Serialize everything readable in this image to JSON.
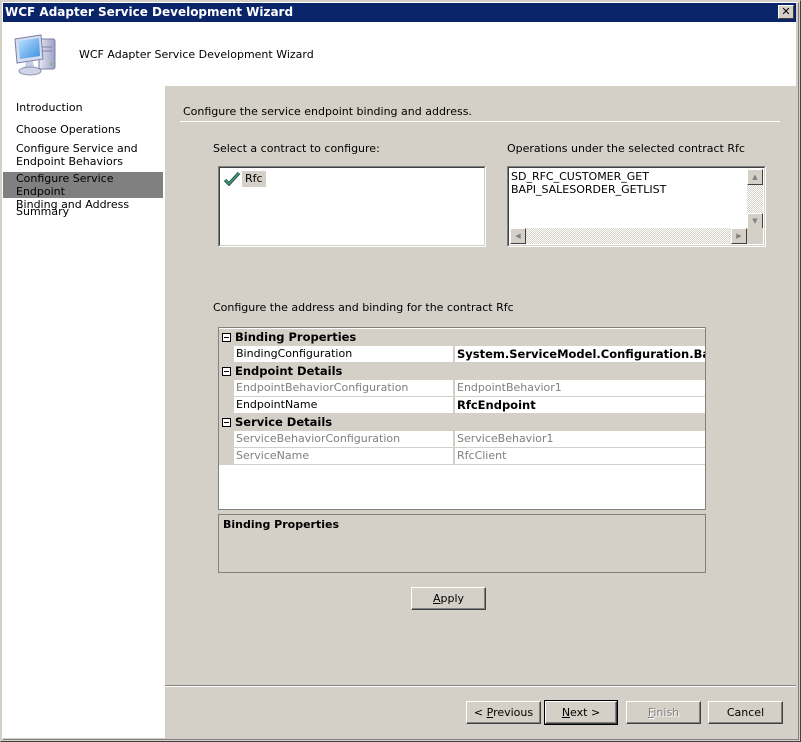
{
  "window": {
    "title": "WCF Adapter Service Development Wizard",
    "close_label": "✕"
  },
  "header": {
    "title": "WCF Adapter Service Development Wizard",
    "icon": "computer-icon"
  },
  "sidebar": {
    "items": [
      {
        "label": "Introduction",
        "active": false
      },
      {
        "label": "Choose Operations",
        "active": false
      },
      {
        "label": "Configure Service and Endpoint Behaviors",
        "line1": "Configure Service and",
        "line2": "Endpoint Behaviors",
        "active": false
      },
      {
        "label": "Configure Service Endpoint Binding and Address",
        "line1": "Configure Service Endpoint",
        "line2": "Binding and Address",
        "active": true
      },
      {
        "label": "Summary",
        "active": false
      }
    ]
  },
  "main": {
    "section_title": "Configure the service endpoint binding and address.",
    "contract_label": "Select a contract to configure:",
    "contracts": [
      {
        "name": "Rfc",
        "checked": true,
        "selected": true
      }
    ],
    "operations_label": "Operations under the selected contract  Rfc",
    "operations": [
      "SD_RFC_CUSTOMER_GET",
      "BAPI_SALESORDER_GETLIST"
    ],
    "address_label": "Configure the address and binding for the contract  Rfc",
    "property_grid": {
      "categories": [
        {
          "name": "Binding Properties",
          "expanded": true,
          "properties": [
            {
              "name": "BindingConfiguration",
              "value": "System.ServiceModel.Configuration.BasicHttpBindingElement",
              "value_display": "System.ServiceModel.Configuration.BasicHt",
              "read_only": false,
              "bold": true
            }
          ]
        },
        {
          "name": "Endpoint Details",
          "expanded": true,
          "properties": [
            {
              "name": "EndpointBehaviorConfiguration",
              "value": "EndpointBehavior1",
              "read_only": true,
              "bold": false
            },
            {
              "name": "EndpointName",
              "value": "RfcEndpoint",
              "read_only": false,
              "bold": true
            }
          ]
        },
        {
          "name": "Service Details",
          "expanded": true,
          "properties": [
            {
              "name": "ServiceBehaviorConfiguration",
              "value": "ServiceBehavior1",
              "read_only": true,
              "bold": false
            },
            {
              "name": "ServiceName",
              "value": "RfcClient",
              "read_only": true,
              "bold": false
            }
          ]
        }
      ],
      "description_title": "Binding Properties"
    },
    "apply_label": "Apply",
    "apply_mnemonic": "A",
    "apply_rest": "pply"
  },
  "footer": {
    "previous": {
      "label": "< Previous",
      "prefix": "< ",
      "mnemonic": "P",
      "rest": "revious",
      "enabled": true
    },
    "next": {
      "label": "Next >",
      "mnemonic": "N",
      "rest": "ext >",
      "enabled": true,
      "default": true
    },
    "finish": {
      "label": "Finish",
      "mnemonic": "F",
      "rest": "inish",
      "enabled": false
    },
    "cancel": {
      "label": "Cancel",
      "enabled": true
    }
  },
  "colors": {
    "titlebar": "#0a246a",
    "face": "#d4d0c8",
    "active_step": "#808080",
    "check": "#2e8b57"
  }
}
